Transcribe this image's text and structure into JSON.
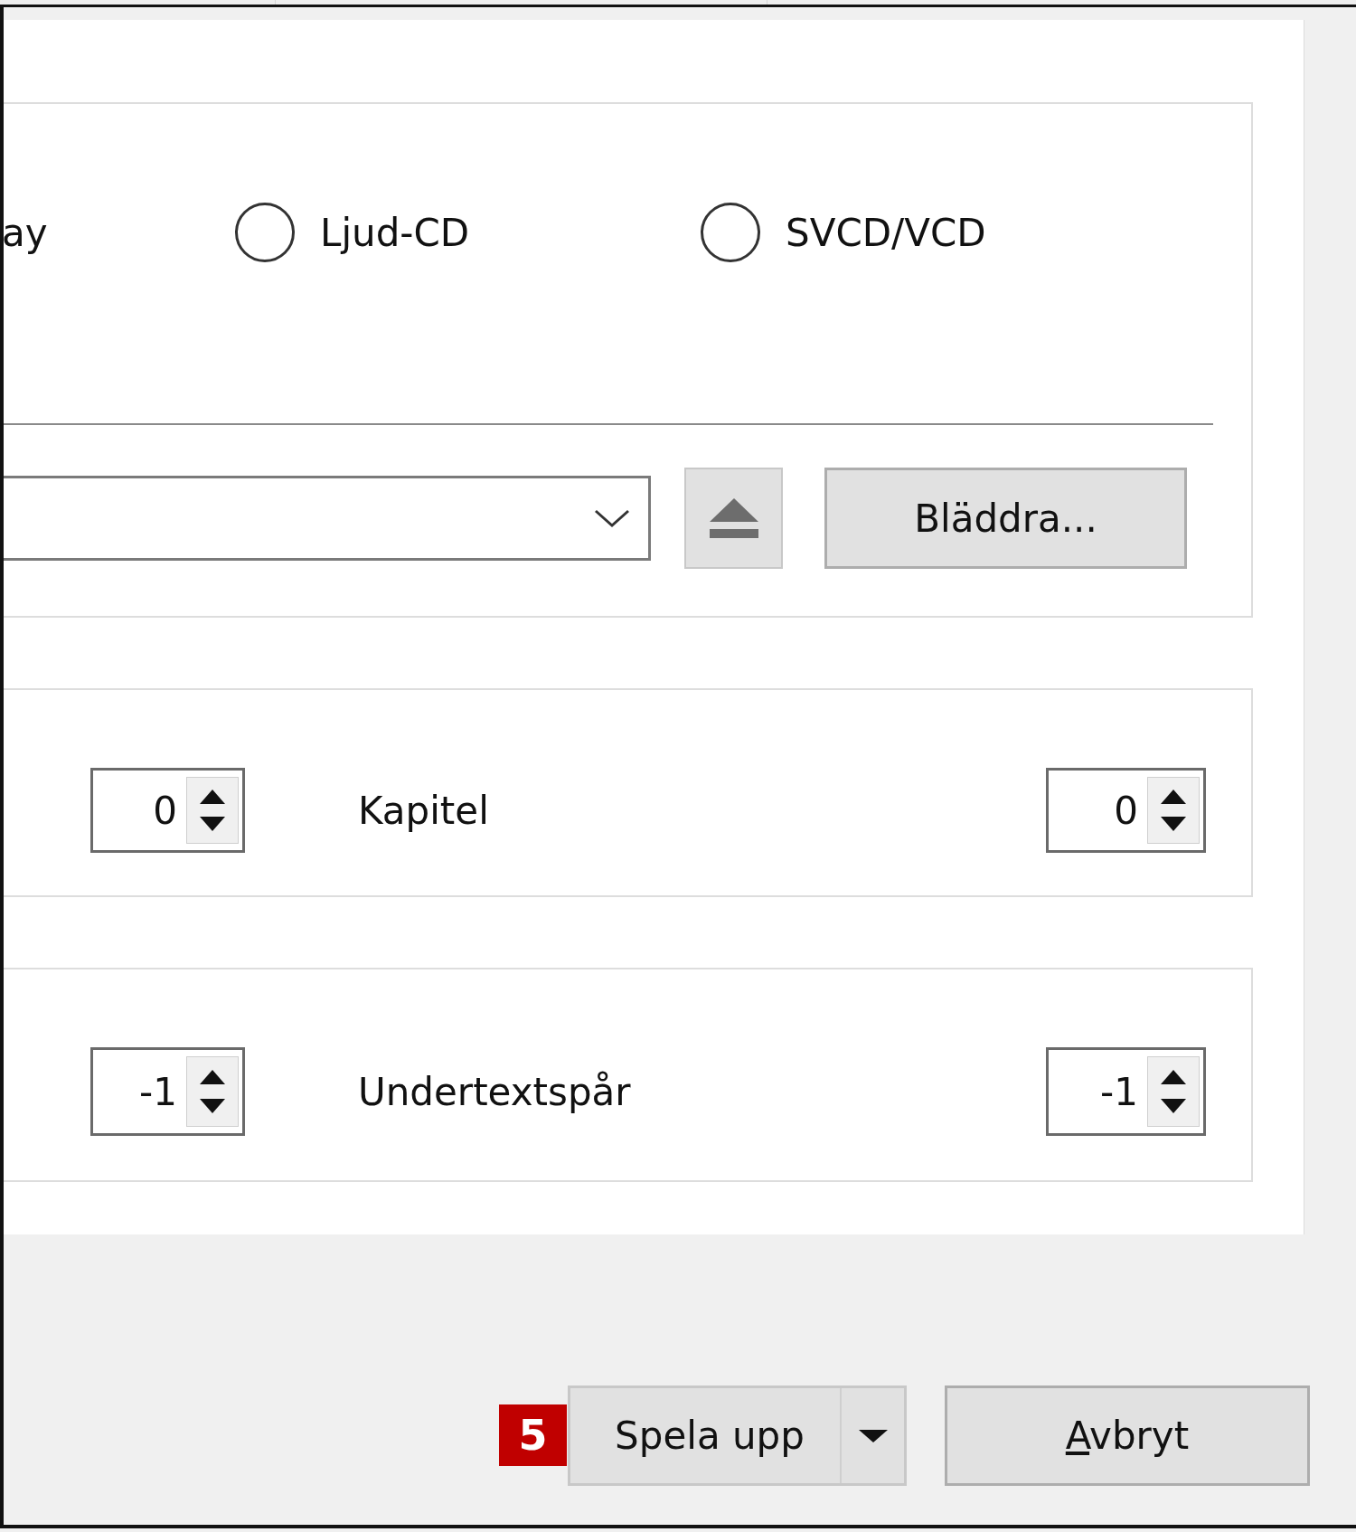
{
  "disc_type": {
    "options": [
      {
        "label": "ay"
      },
      {
        "label": "Ljud-CD",
        "selected": false
      },
      {
        "label": "SVCD/VCD",
        "selected": false
      }
    ]
  },
  "device": {
    "browse_button": "Bläddra..."
  },
  "start_position": {
    "title_value": "0",
    "chapter_label": "Kapitel",
    "chapter_value": "0"
  },
  "audio_subtitles": {
    "audio_value": "-1",
    "subtitle_label": "Undertextspår",
    "subtitle_value": "-1"
  },
  "buttons": {
    "badge": "5",
    "play": "Spela upp",
    "cancel": "Avbryt",
    "cancel_access_key_underlined": true
  }
}
